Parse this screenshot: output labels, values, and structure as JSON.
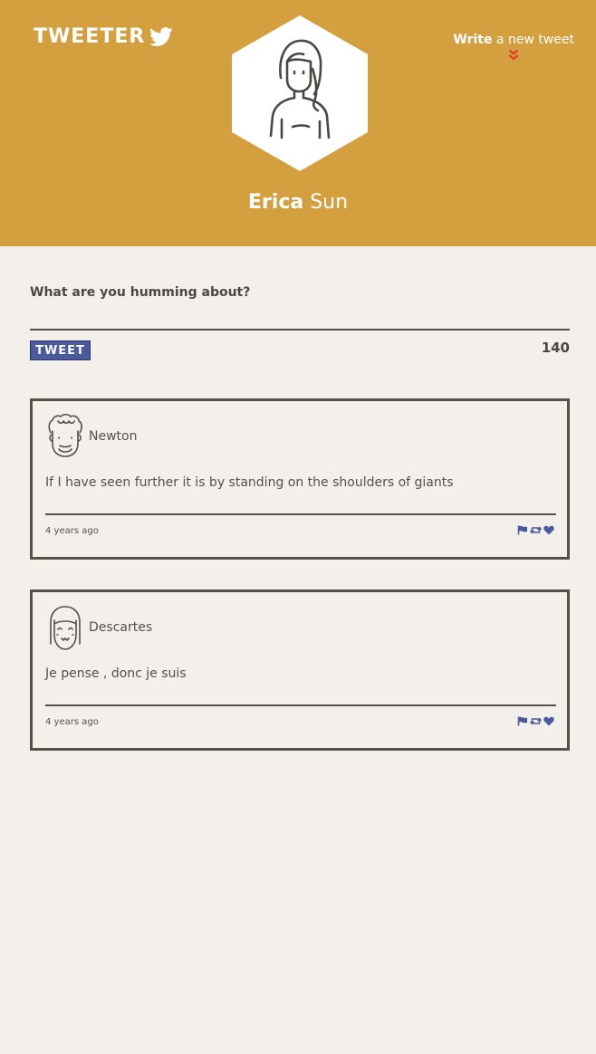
{
  "header": {
    "logo_text": "TWEETER",
    "logo_icon": "twitter-bird-icon",
    "write_strong": "Write",
    "write_rest": " a new tweet",
    "write_icon": "double-chevron-down-icon",
    "profile_first": "Erica",
    "profile_last": "Sun"
  },
  "compose": {
    "label": "What are you humming about?",
    "placeholder": "",
    "button_label": "TWEET",
    "counter": "140"
  },
  "tweets": [
    {
      "author": "Newton",
      "content": "If I have seen further it is by standing on the shoulders of giants",
      "time": "4 years ago"
    },
    {
      "author": "Descartes",
      "content": "Je pense , donc je suis",
      "time": "4 years ago"
    }
  ],
  "icons": {
    "flag": "flag-icon",
    "retweet": "retweet-icon",
    "like": "heart-icon"
  },
  "colors": {
    "header_bg": "#d4a03f",
    "page_bg": "#f3f0ec",
    "accent_blue": "#4b5a9c",
    "chevron_red": "#e0432b",
    "text": "#545149"
  }
}
